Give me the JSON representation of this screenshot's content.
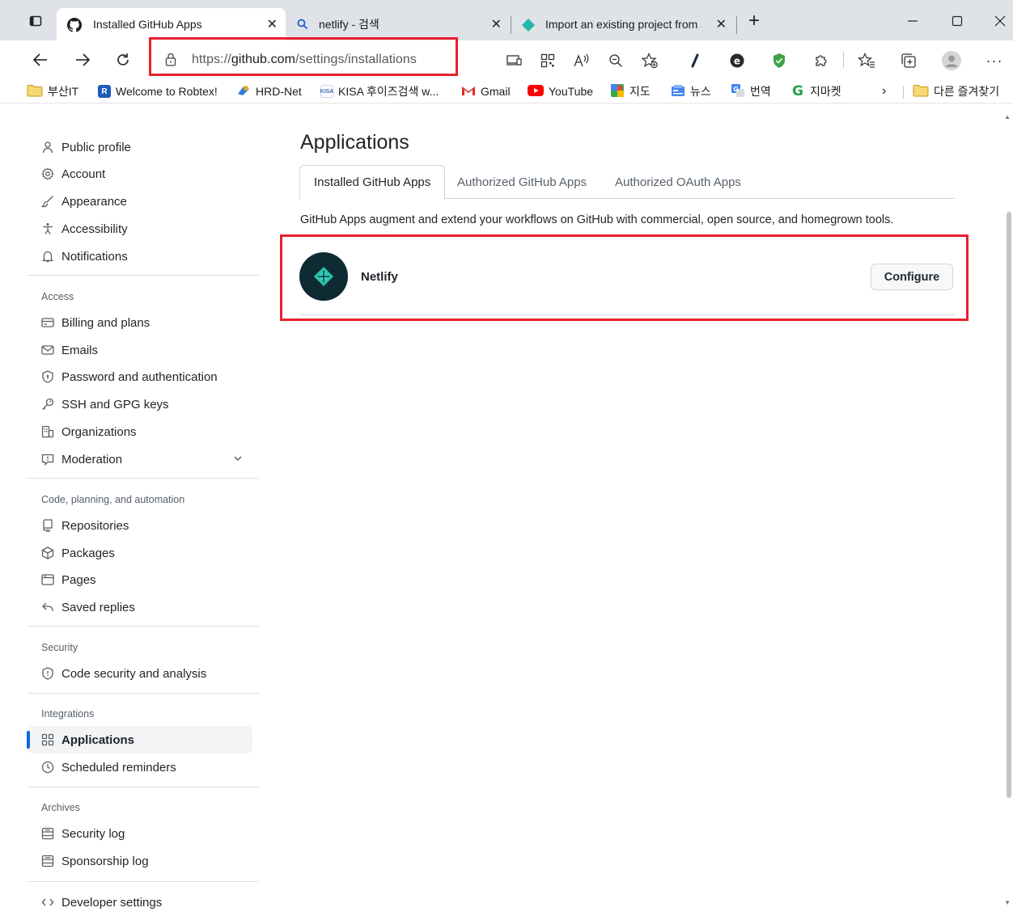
{
  "browser": {
    "tabs": [
      {
        "title": "Installed GitHub Apps",
        "icon": "github-icon",
        "active": true
      },
      {
        "title": "netlify - 검색",
        "icon": "search-icon",
        "active": false
      },
      {
        "title": "Import an existing project from a",
        "icon": "netlify-icon",
        "active": false
      }
    ],
    "new_tab": "+",
    "address": {
      "scheme": "https://",
      "host": "github.com",
      "path": "/settings/installations"
    },
    "bookmarks": [
      {
        "label": "부산IT",
        "icon": "folder-icon"
      },
      {
        "label": "Welcome to Robtex!",
        "icon": "robtex-icon"
      },
      {
        "label": "HRD-Net",
        "icon": "hrdnet-icon"
      },
      {
        "label": "KISA 후이즈검색 w...",
        "icon": "kisa-icon"
      },
      {
        "label": "Gmail",
        "icon": "gmail-icon"
      },
      {
        "label": "YouTube",
        "icon": "youtube-icon"
      },
      {
        "label": "지도",
        "icon": "maps-icon"
      },
      {
        "label": "뉴스",
        "icon": "news-icon"
      },
      {
        "label": "번역",
        "icon": "translate-icon"
      },
      {
        "label": "지마켓",
        "icon": "gmarket-icon"
      }
    ],
    "other_favorites": "다른 즐겨찾기"
  },
  "sidebar": {
    "top_items": [
      {
        "label": "Public profile",
        "icon": "person-icon"
      },
      {
        "label": "Account",
        "icon": "gear-icon"
      },
      {
        "label": "Appearance",
        "icon": "paintbrush-icon"
      },
      {
        "label": "Accessibility",
        "icon": "accessibility-icon"
      },
      {
        "label": "Notifications",
        "icon": "bell-icon"
      }
    ],
    "access_heading": "Access",
    "access_items": [
      {
        "label": "Billing and plans",
        "icon": "credit-card-icon"
      },
      {
        "label": "Emails",
        "icon": "mail-icon"
      },
      {
        "label": "Password and authentication",
        "icon": "shield-lock-icon"
      },
      {
        "label": "SSH and GPG keys",
        "icon": "key-icon"
      },
      {
        "label": "Organizations",
        "icon": "organization-icon"
      },
      {
        "label": "Moderation",
        "icon": "report-icon"
      }
    ],
    "code_heading": "Code, planning, and automation",
    "code_items": [
      {
        "label": "Repositories",
        "icon": "repo-icon"
      },
      {
        "label": "Packages",
        "icon": "package-icon"
      },
      {
        "label": "Pages",
        "icon": "browser-icon"
      },
      {
        "label": "Saved replies",
        "icon": "reply-icon"
      }
    ],
    "security_heading": "Security",
    "security_items": [
      {
        "label": "Code security and analysis",
        "icon": "shield-icon"
      }
    ],
    "integrations_heading": "Integrations",
    "integrations_items": [
      {
        "label": "Applications",
        "icon": "apps-icon",
        "selected": true
      },
      {
        "label": "Scheduled reminders",
        "icon": "clock-icon"
      }
    ],
    "archives_heading": "Archives",
    "archives_items": [
      {
        "label": "Security log",
        "icon": "log-icon"
      },
      {
        "label": "Sponsorship log",
        "icon": "log-icon"
      }
    ],
    "developer_settings": {
      "label": "Developer settings",
      "icon": "code-icon"
    }
  },
  "main": {
    "title": "Applications",
    "tabs": [
      "Installed GitHub Apps",
      "Authorized GitHub Apps",
      "Authorized OAuth Apps"
    ],
    "intro": "GitHub Apps augment and extend your workflows on GitHub with commercial, open source, and homegrown tools.",
    "apps": [
      {
        "name": "Netlify",
        "button": "Configure"
      }
    ]
  },
  "colors": {
    "highlight": "#e8202f",
    "accent": "#0969da",
    "netlify": "#2fbfa7"
  }
}
